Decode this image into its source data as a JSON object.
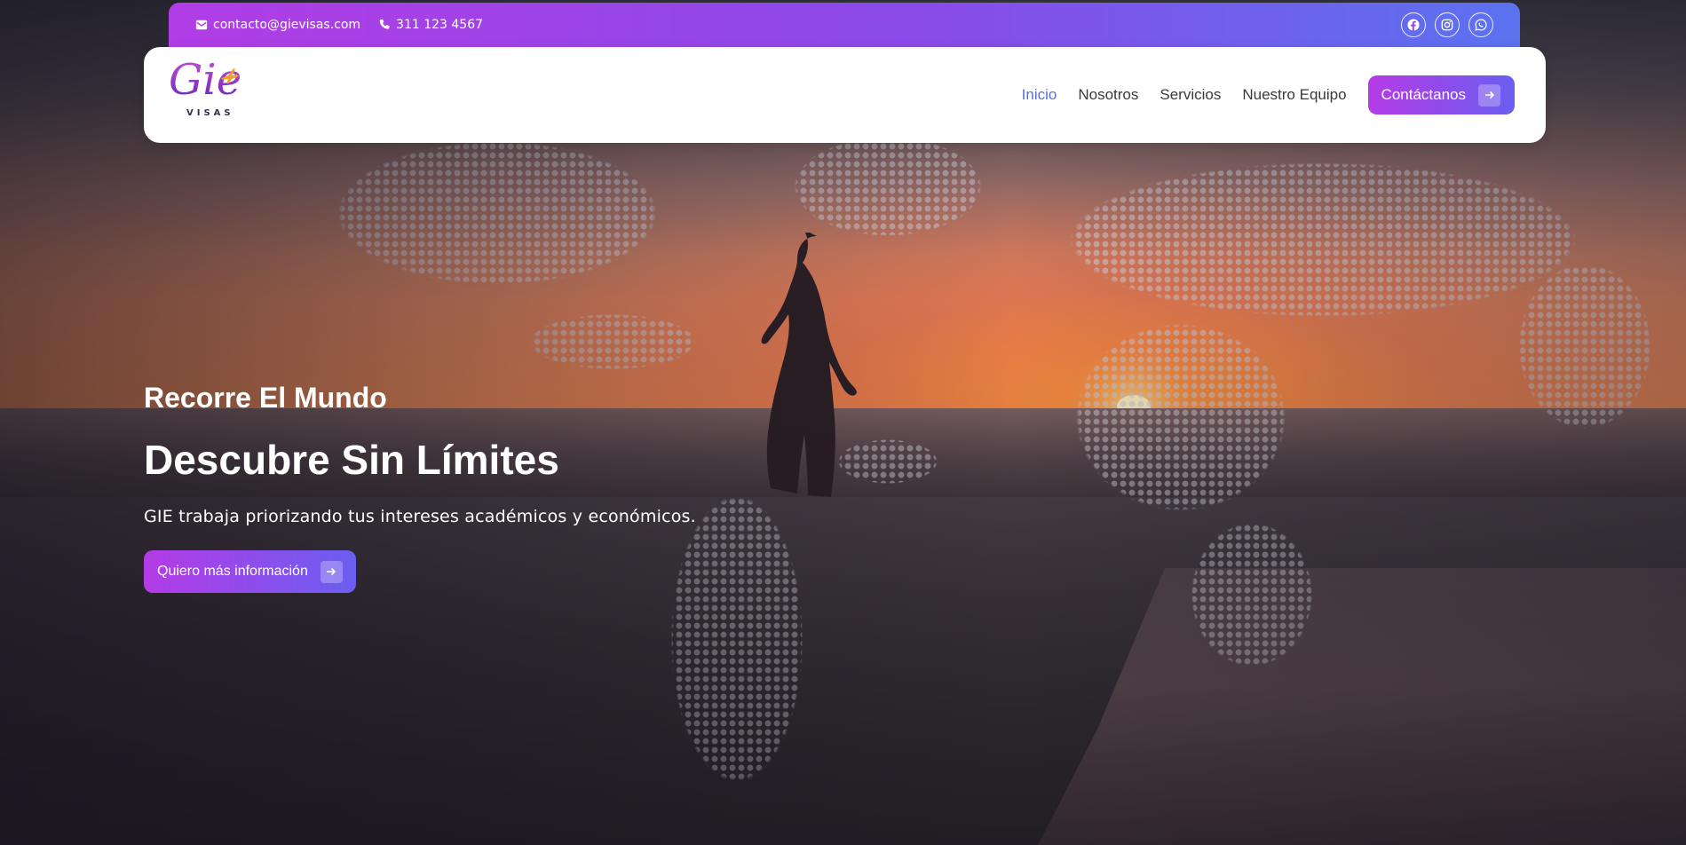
{
  "topbar": {
    "email": "contacto@gievisas.com",
    "phone": "311 123 4567",
    "social_icons": [
      "facebook-icon",
      "instagram-icon",
      "whatsapp-icon"
    ],
    "gradient": [
      "#b13de6",
      "#5b72f0"
    ]
  },
  "brand": {
    "logo_script": "Gie",
    "logo_sub": "VISAS"
  },
  "nav": {
    "items": [
      {
        "label": "Inicio",
        "active": true
      },
      {
        "label": "Nosotros",
        "active": false
      },
      {
        "label": "Servicios",
        "active": false
      },
      {
        "label": "Nuestro Equipo",
        "active": false
      }
    ],
    "cta_label": "Contáctanos",
    "active_color": "#5b6fd6"
  },
  "hero": {
    "kicker": "Recorre El Mundo",
    "headline": "Descubre Sin Límites",
    "subtitle": "GIE trabaja priorizando tus intereses académicos y económicos.",
    "cta_label": "Quiero más información"
  }
}
